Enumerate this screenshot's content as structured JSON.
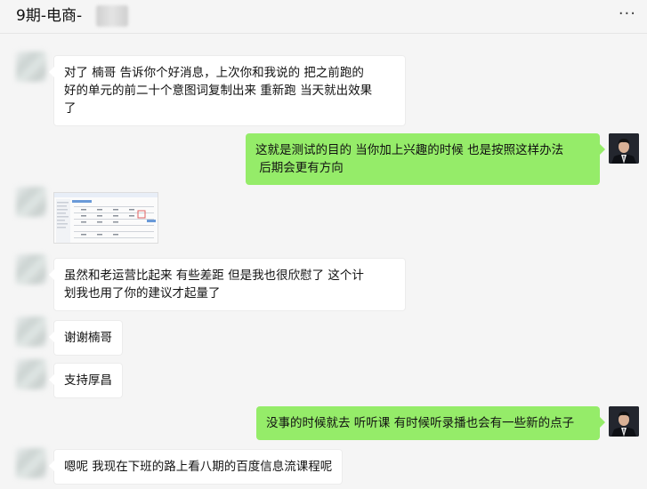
{
  "header": {
    "title": "9期-电商-",
    "more_icon": "···"
  },
  "colors": {
    "self_bubble": "#95ec69",
    "other_bubble": "#ffffff",
    "background": "#f5f5f5"
  },
  "messages": [
    {
      "sender": "other",
      "text_lines": [
        "对了  楠哥    告诉你个好消息，上次你和我说的  把之前跑的",
        "好的单元的前二十个意图词复制出来  重新跑    当天就出效果",
        "了"
      ]
    },
    {
      "sender": "self",
      "text_lines": [
        "这就是测试的目的  当你加上兴趣的时候    也是按照这样办法",
        " 后期会更有方向"
      ]
    },
    {
      "sender": "other",
      "type": "image",
      "image_alt": "screenshot-thumbnail"
    },
    {
      "sender": "other",
      "text_lines": [
        "虽然和老运营比起来    有些差距    但是我也很欣慰了     这个计",
        "划我也用了你的建议才起量了"
      ]
    },
    {
      "sender": "other",
      "text_lines": [
        "谢谢楠哥"
      ]
    },
    {
      "sender": "other",
      "text_lines": [
        "支持厚昌"
      ]
    },
    {
      "sender": "self",
      "text_lines": [
        "没事的时候就去 听听课    有时候听录播也会有一些新的点子"
      ]
    },
    {
      "sender": "other",
      "text_lines": [
        "嗯呢    我现在下班的路上看八期的百度信息流课程呢"
      ]
    }
  ]
}
